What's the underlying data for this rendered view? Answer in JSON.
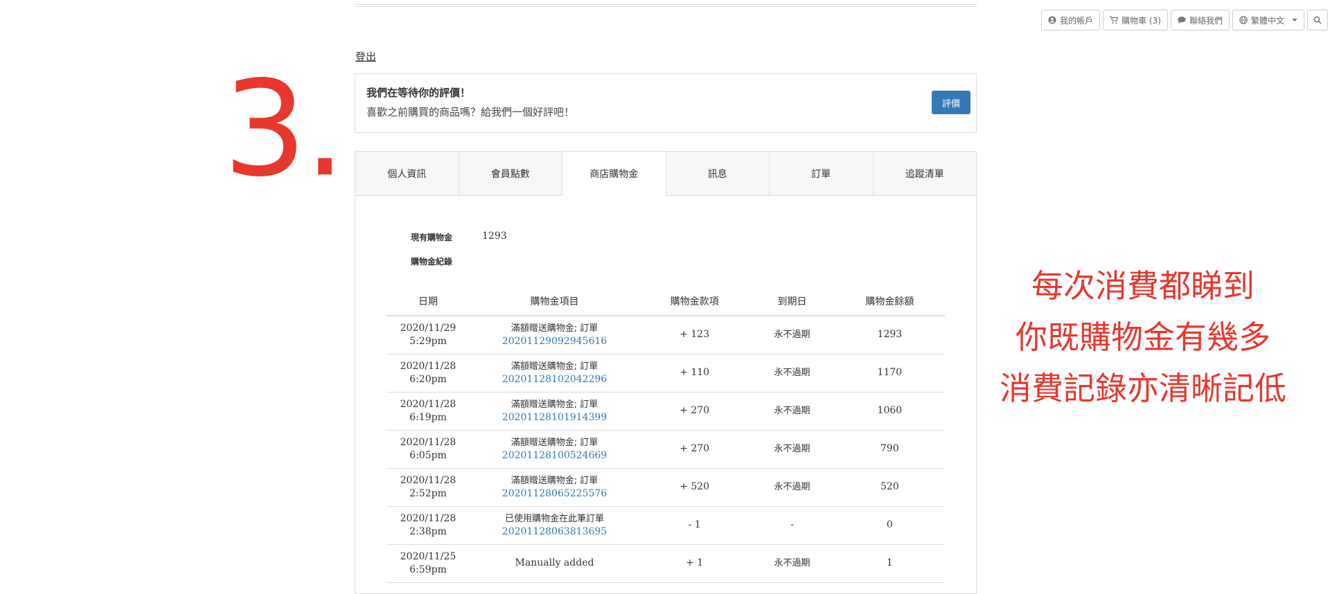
{
  "toolbar": {
    "account": "我的帳戶",
    "cart": "購物車 (3)",
    "contact": "聯絡我們",
    "language": "繁體中文"
  },
  "overlay": {
    "step_number": "3.",
    "annotation_lines": [
      "每次消費都睇到",
      "你既購物金有幾多",
      "消費記錄亦清晰記低"
    ]
  },
  "logout": "登出",
  "review": {
    "title": "我們在等待你的評價！",
    "subtitle": "喜歡之前購買的商品嗎？給我們一個好評吧！",
    "button": "評價"
  },
  "tabs": [
    "個人資訊",
    "會員點數",
    "商店購物金",
    "訊息",
    "訂單",
    "追蹤清單"
  ],
  "active_tab": "商店購物金",
  "credit": {
    "current_label": "現有購物金",
    "current_value": "1293",
    "records_label": "購物金紀錄"
  },
  "table": {
    "headers": [
      "日期",
      "購物金項目",
      "購物金款項",
      "到期日",
      "購物金餘額"
    ],
    "rows": [
      {
        "date": "2020/11/29 5:29pm",
        "item_prefix": "滿額贈送購物金; 訂單 ",
        "order": "20201129092945616",
        "amount": "+ 123",
        "expiry": "永不過期",
        "balance": "1293"
      },
      {
        "date": "2020/11/28 6:20pm",
        "item_prefix": "滿額贈送購物金; 訂單 ",
        "order": "20201128102042296",
        "amount": "+ 110",
        "expiry": "永不過期",
        "balance": "1170"
      },
      {
        "date": "2020/11/28 6:19pm",
        "item_prefix": "滿額贈送購物金; 訂單 ",
        "order": "20201128101914399",
        "amount": "+ 270",
        "expiry": "永不過期",
        "balance": "1060"
      },
      {
        "date": "2020/11/28 6:05pm",
        "item_prefix": "滿額贈送購物金; 訂單 ",
        "order": "20201128100524669",
        "amount": "+ 270",
        "expiry": "永不過期",
        "balance": "790"
      },
      {
        "date": "2020/11/28 2:52pm",
        "item_prefix": "滿額贈送購物金; 訂單 ",
        "order": "20201128065225576",
        "amount": "+ 520",
        "expiry": "永不過期",
        "balance": "520"
      },
      {
        "date": "2020/11/28 2:38pm",
        "item_prefix": "已使用購物金在此筆訂單 ",
        "order": "20201128063813695",
        "amount": "- 1",
        "expiry": "-",
        "balance": "0"
      },
      {
        "date": "2020/11/25 6:59pm",
        "item_prefix": "Manually added",
        "order": "",
        "amount": "+ 1",
        "expiry": "永不過期",
        "balance": "1"
      }
    ]
  }
}
